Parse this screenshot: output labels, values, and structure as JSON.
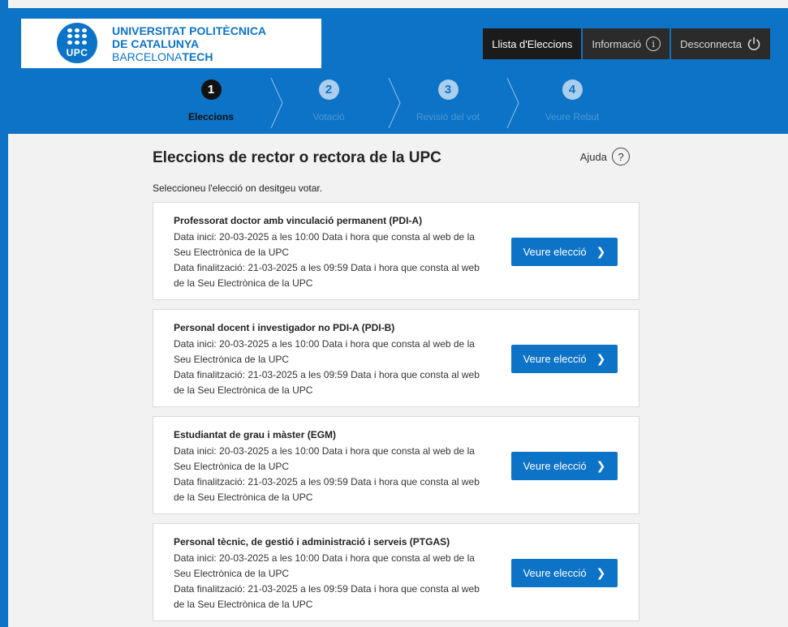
{
  "brand": {
    "mark_text": "UPC",
    "line1": "UNIVERSITAT POLITÈCNICA",
    "line2": "DE CATALUNYA",
    "line3_regular": "BARCELONA",
    "line3_bold": "TECH"
  },
  "topnav": [
    {
      "label": "Llista d'Eleccions",
      "icon": ""
    },
    {
      "label": "Informació",
      "icon": "i"
    },
    {
      "label": "Desconnecta",
      "icon": "⏻"
    }
  ],
  "steps": [
    {
      "num": "1",
      "label": "Eleccions"
    },
    {
      "num": "2",
      "label": "Votació"
    },
    {
      "num": "3",
      "label": "Revisió del vot"
    },
    {
      "num": "4",
      "label": "Veure Rebut"
    }
  ],
  "page": {
    "title": "Eleccions de rector o rectora de la UPC",
    "help_label": "Ajuda",
    "help_icon": "?",
    "instruction": "Seleccioneu l'elecció on desitgeu votar."
  },
  "elections": [
    {
      "title": "Professorat doctor amb vinculació permanent (PDI-A)",
      "start": "Data inici: 20-03-2025 a les 10:00 Data i hora que consta al web de la Seu Electrònica de la UPC",
      "end": "Data finalització: 21-03-2025 a les 09:59 Data i hora que consta al web de la Seu Electrònica de la UPC",
      "button": "Veure elecció"
    },
    {
      "title": "Personal docent i investigador no PDI-A (PDI-B)",
      "start": "Data inici: 20-03-2025 a les 10:00 Data i hora que consta al web de la Seu Electrònica de la UPC",
      "end": "Data finalització: 21-03-2025 a les 09:59 Data i hora que consta al web de la Seu Electrònica de la UPC",
      "button": "Veure elecció"
    },
    {
      "title": "Estudiantat de grau i màster (EGM)",
      "start": "Data inici: 20-03-2025 a les 10:00 Data i hora que consta al web de la Seu Electrònica de la UPC",
      "end": "Data finalització: 21-03-2025 a les 09:59 Data i hora que consta al web de la Seu Electrònica de la UPC",
      "button": "Veure elecció"
    },
    {
      "title": "Personal tècnic, de gestió i administració i serveis (PTGAS)",
      "start": "Data inici: 20-03-2025 a les 10:00 Data i hora que consta al web de la Seu Electrònica de la UPC",
      "end": "Data finalització: 21-03-2025 a les 09:59 Data i hora que consta al web de la Seu Electrònica de la UPC",
      "button": "Veure elecció"
    }
  ],
  "colors": {
    "brand_blue": "#0d73c7",
    "nav_dark": "#2b2b2b",
    "page_bg": "#f2f2f2"
  }
}
